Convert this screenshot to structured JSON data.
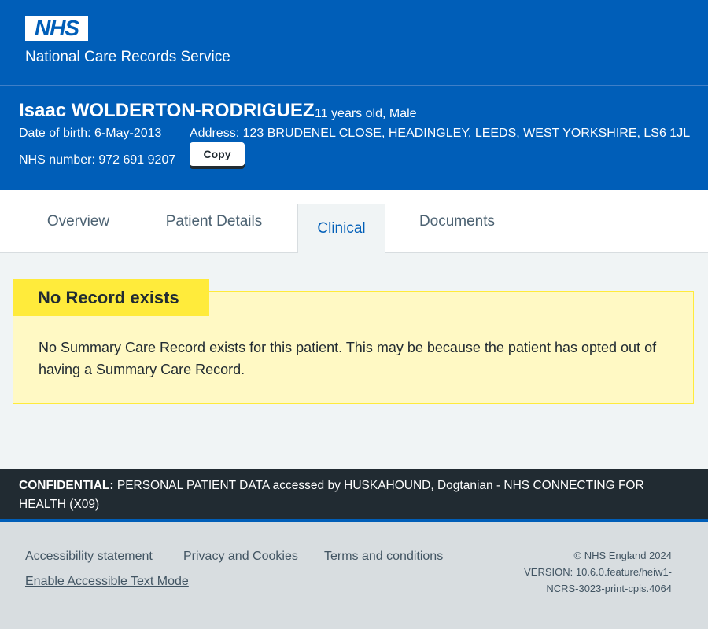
{
  "header": {
    "logo_text": "NHS",
    "service_name": "National Care Records Service"
  },
  "patient": {
    "name": "Isaac WOLDERTON-RODRIGUEZ",
    "age_gender": "11 years old, Male",
    "dob": "Date of birth: 6-May-2013",
    "address": "Address: 123 BRUDENEL CLOSE, HEADINGLEY, LEEDS, WEST YORKSHIRE, LS6 1JL",
    "nhs_number": "NHS number: 972 691 9207",
    "copy_label": "Copy"
  },
  "tabs": [
    {
      "label": "Overview",
      "active": false
    },
    {
      "label": "Patient Details",
      "active": false
    },
    {
      "label": "Clinical",
      "active": true
    },
    {
      "label": "Documents",
      "active": false
    }
  ],
  "warning": {
    "label": "No Record exists",
    "text": "No Summary Care Record exists for this patient. This may be because the patient has opted out of having a Summary Care Record."
  },
  "confidential": {
    "label": "CONFIDENTIAL:",
    "text": " PERSONAL PATIENT DATA accessed by HUSKAHOUND, Dogtanian - NHS CONNECTING FOR HEALTH (X09)"
  },
  "footer": {
    "links": [
      "Accessibility statement",
      "Privacy and Cookies",
      "Terms and conditions",
      "Enable Accessible Text Mode"
    ],
    "copyright": "© NHS England 2024",
    "version_line1": "VERSION: 10.6.0.feature/heiw1-",
    "version_line2": "NCRS-3023-print-cpis.4064"
  },
  "colors": {
    "nhs_blue": "#005eb8",
    "warning_yellow": "#ffeb3b",
    "warning_bg": "#fff9c4",
    "dark": "#212b32",
    "footer_bg": "#d8dde0"
  }
}
